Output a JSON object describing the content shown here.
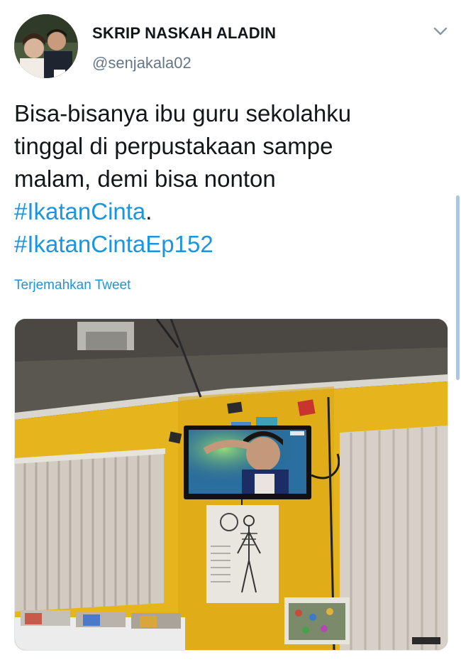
{
  "tweet": {
    "display_name": "SKRIP NASKAH ALADIN",
    "handle": "@senjakala02",
    "text_lines": [
      "Bisa-bisanya ibu guru sekolahku",
      "tinggal di perpustakaan sampe",
      "malam, demi bisa nonton"
    ],
    "hashtag_1": "#IkatanCinta",
    "hashtag_1_suffix": ".",
    "hashtag_2": "#IkatanCintaEp152",
    "translate_label": "Terjemahkan Tweet"
  },
  "icons": {
    "menu": "chevron-down-icon"
  },
  "colors": {
    "link": "#1b95e0",
    "handle": "#657786",
    "text": "#14171a",
    "wall": "#e8b81e"
  }
}
